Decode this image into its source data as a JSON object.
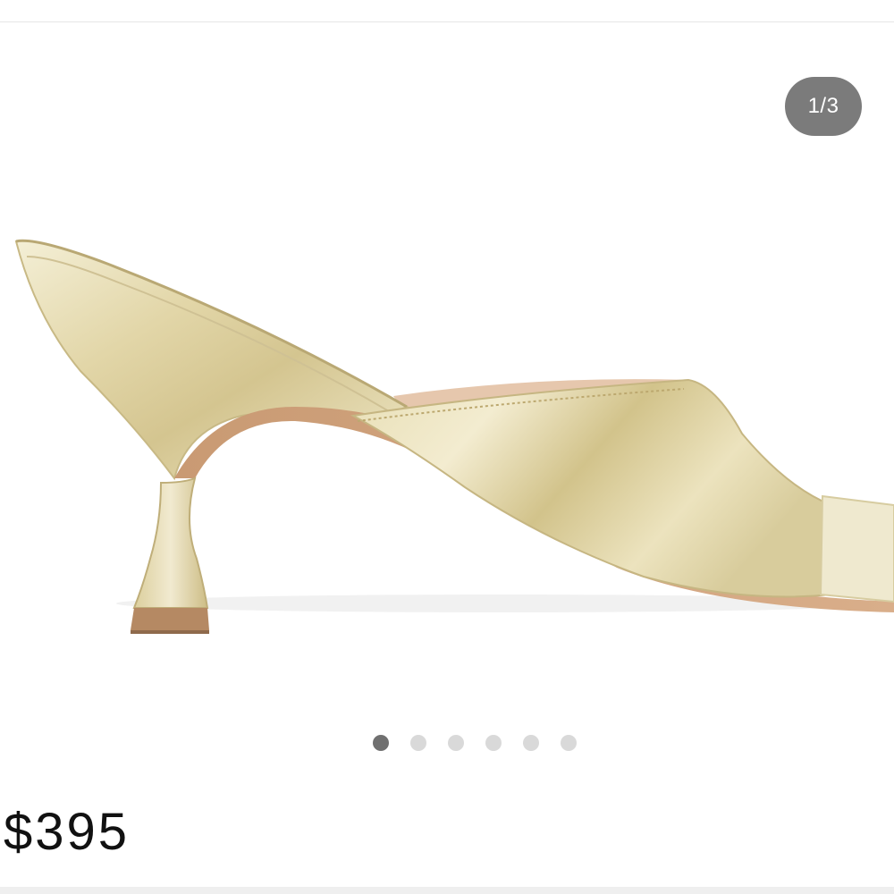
{
  "gallery": {
    "counter": "1/3",
    "image_icon": "gold-metallic-mule-sandal",
    "dots": [
      {
        "active": true
      },
      {
        "active": false
      },
      {
        "active": false
      },
      {
        "active": false
      },
      {
        "active": false
      },
      {
        "active": false
      }
    ]
  },
  "product": {
    "price": "$395"
  },
  "colors": {
    "badge": "#7b7b7b",
    "active_dot": "#707070",
    "inactive_dot": "#d9d9d9"
  }
}
